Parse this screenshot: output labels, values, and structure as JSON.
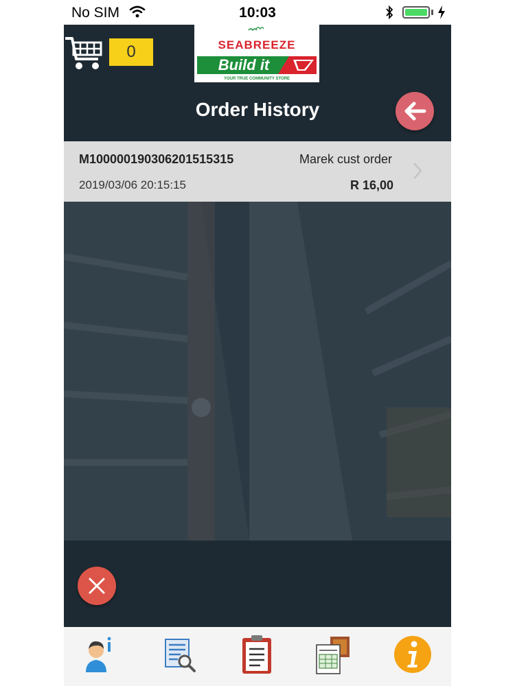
{
  "status_bar": {
    "carrier": "No SIM",
    "time": "10:03",
    "battery_level": 1.0
  },
  "header": {
    "cart_count": "0",
    "logo": {
      "top_text": "SEABREEZE",
      "brand_text": "Build it",
      "tagline": "YOUR TRUE COMMUNITY STORE"
    },
    "title": "Order History",
    "back_icon": "arrow-left-icon"
  },
  "orders": [
    {
      "order_id": "M10000019030620151531​5",
      "customer": "Marek cust order",
      "date": "2019/03/06 20:15:15",
      "total": "R 16,00"
    }
  ],
  "bottom_tabs": [
    {
      "icon": "user-info-icon"
    },
    {
      "icon": "document-search-icon"
    },
    {
      "icon": "clipboard-list-icon"
    },
    {
      "icon": "order-sheets-icon"
    },
    {
      "icon": "info-icon"
    }
  ],
  "colors": {
    "app_background": "#1e2a33",
    "cart_badge": "#f7d019",
    "back_button": "#d9636e",
    "close_button": "#dd5549",
    "order_row": "#dcdcdc",
    "brand_red": "#d9232d",
    "brand_green": "#1d8f3b"
  }
}
